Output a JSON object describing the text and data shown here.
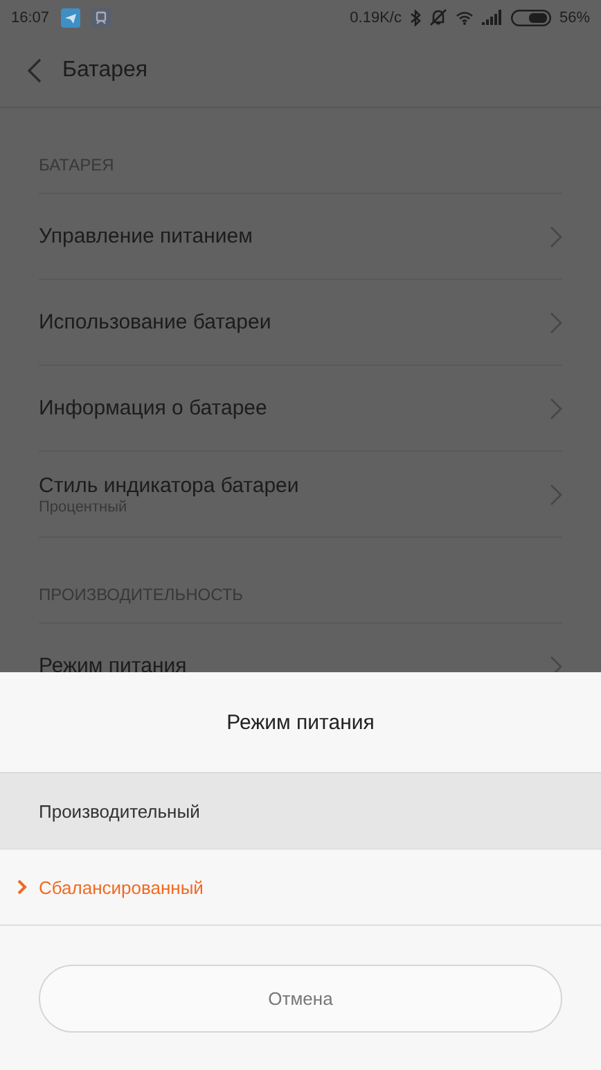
{
  "status_bar": {
    "time": "16:07",
    "speed": "0.19K/c",
    "battery": "56%"
  },
  "header": {
    "back": true,
    "title": "Батарея"
  },
  "sections": [
    {
      "title": "БАТАРЕЯ",
      "items": [
        {
          "label": "Управление питанием"
        },
        {
          "label": "Использование батареи"
        },
        {
          "label": "Информация о батарее"
        },
        {
          "label": "Стиль индикатора батареи",
          "subtitle": "Процентный"
        }
      ]
    },
    {
      "title": "ПРОИЗВОДИТЕЛЬНОСТЬ",
      "items": [
        {
          "label": "Режим питания"
        }
      ]
    }
  ],
  "sheet": {
    "title": "Режим питания",
    "options": [
      {
        "label": "Производительный",
        "selected": false,
        "highlighted": true
      },
      {
        "label": "Сбалансированный",
        "selected": true,
        "highlighted": false
      }
    ],
    "cancel": "Отмена"
  }
}
